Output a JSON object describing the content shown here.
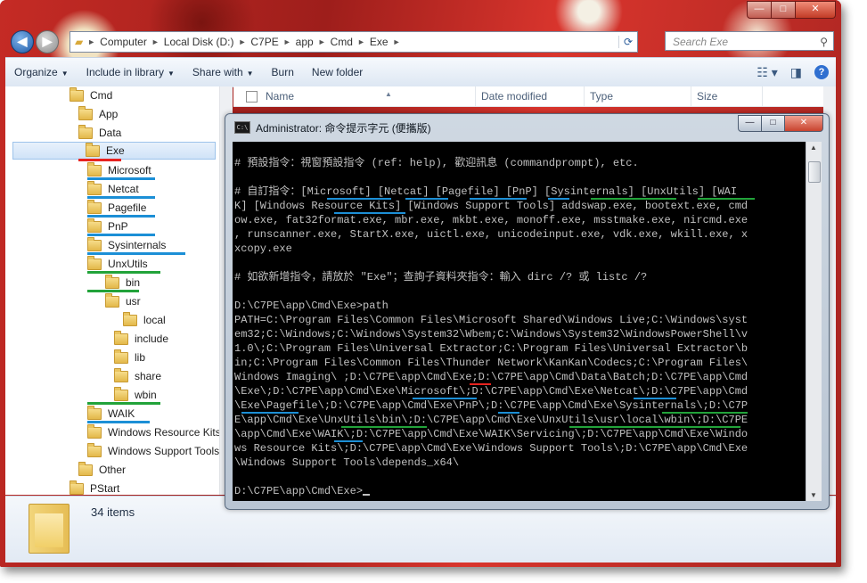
{
  "address_bar": {
    "segments": [
      "Computer",
      "Local Disk (D:)",
      "C7PE",
      "app",
      "Cmd",
      "Exe"
    ],
    "search_placeholder": "Search Exe"
  },
  "toolbar": {
    "organize": "Organize",
    "include_in_library": "Include in library",
    "share_with": "Share with",
    "burn": "Burn",
    "new_folder": "New folder"
  },
  "columns": {
    "name": "Name",
    "date_modified": "Date modified",
    "type": "Type",
    "size": "Size"
  },
  "nav_tree": [
    {
      "label": "Cmd",
      "level": 0
    },
    {
      "label": "App",
      "level": 1
    },
    {
      "label": "Data",
      "level": 1
    },
    {
      "label": "Exe",
      "level": 1,
      "selected": true
    },
    {
      "label": "Microsoft",
      "level": 2
    },
    {
      "label": "Netcat",
      "level": 2
    },
    {
      "label": "Pagefile",
      "level": 2
    },
    {
      "label": "PnP",
      "level": 2
    },
    {
      "label": "Sysinternals",
      "level": 2
    },
    {
      "label": "UnxUtils",
      "level": 2
    },
    {
      "label": "bin",
      "level": 3
    },
    {
      "label": "usr",
      "level": 3
    },
    {
      "label": "local",
      "level": 4
    },
    {
      "label": "include",
      "level": 5
    },
    {
      "label": "lib",
      "level": 5
    },
    {
      "label": "share",
      "level": 5
    },
    {
      "label": "wbin",
      "level": 5
    },
    {
      "label": "WAIK",
      "level": 2
    },
    {
      "label": "Windows Resource Kits",
      "level": 2
    },
    {
      "label": "Windows Support Tools",
      "level": 2
    },
    {
      "label": "Other",
      "level": 1
    },
    {
      "label": "PStart",
      "level": 0
    }
  ],
  "details": {
    "item_count": "34 items"
  },
  "console": {
    "title": "Administrator:  命令提示字元 (便攜版)",
    "lines": [
      "",
      "# 預設指令：視窗預設指令 (ref: help), 歡迎訊息 (commandprompt), etc.",
      "",
      "# 自訂指令：[Microsoft] [Netcat] [Pagefile] [PnP] [Sysinternals] [UnxUtils] [WAI",
      "K] [Windows Resource Kits] [Windows Support Tools] addswap.exe, bootext.exe, cmd",
      "ow.exe, fat32format.exe, mbr.exe, mkbt.exe, monoff.exe, msstmake.exe, nircmd.exe",
      ", runscanner.exe, StartX.exe, uictl.exe, unicodeinput.exe, vdk.exe, wkill.exe, x",
      "xcopy.exe",
      "",
      "# 如欲新增指令，請放於 \"Exe\"；查詢子資料夾指令：輸入 dirc /? 或 listc /?",
      "",
      "D:\\C7PE\\app\\Cmd\\Exe>path",
      "PATH=C:\\Program Files\\Common Files\\Microsoft Shared\\Windows Live;C:\\Windows\\syst",
      "em32;C:\\Windows;C:\\Windows\\System32\\Wbem;C:\\Windows\\System32\\WindowsPowerShell\\v",
      "1.0\\;C:\\Program Files\\Universal Extractor;C:\\Program Files\\Universal Extractor\\b",
      "in;C:\\Program Files\\Common Files\\Thunder Network\\KanKan\\Codecs;C:\\Program Files\\",
      "Windows Imaging\\ ;D:\\C7PE\\app\\Cmd\\Exe;D:\\C7PE\\app\\Cmd\\Data\\Batch;D:\\C7PE\\app\\Cmd",
      "\\Exe\\;D:\\C7PE\\app\\Cmd\\Exe\\Microsoft\\;D:\\C7PE\\app\\Cmd\\Exe\\Netcat\\;D:\\C7PE\\app\\Cmd",
      "\\Exe\\Pagefile\\;D:\\C7PE\\app\\Cmd\\Exe\\PnP\\;D:\\C7PE\\app\\Cmd\\Exe\\Sysinternals\\;D:\\C7P",
      "E\\app\\Cmd\\Exe\\UnxUtils\\bin\\;D:\\C7PE\\app\\Cmd\\Exe\\UnxUtils\\usr\\local\\wbin\\;D:\\C7PE",
      "\\app\\Cmd\\Exe\\WAIK\\;D:\\C7PE\\app\\Cmd\\Exe\\WAIK\\Servicing\\;D:\\C7PE\\app\\Cmd\\Exe\\Windo",
      "ws Resource Kits\\;D:\\C7PE\\app\\Cmd\\Exe\\Windows Support Tools\\;D:\\C7PE\\app\\Cmd\\Exe",
      "\\Windows Support Tools\\depends_x64\\",
      "",
      "D:\\C7PE\\app\\Cmd\\Exe>"
    ]
  },
  "colors": {
    "red_mark": "#e8231f",
    "blue_mark": "#1c8fd6",
    "green_mark": "#22a33a"
  }
}
